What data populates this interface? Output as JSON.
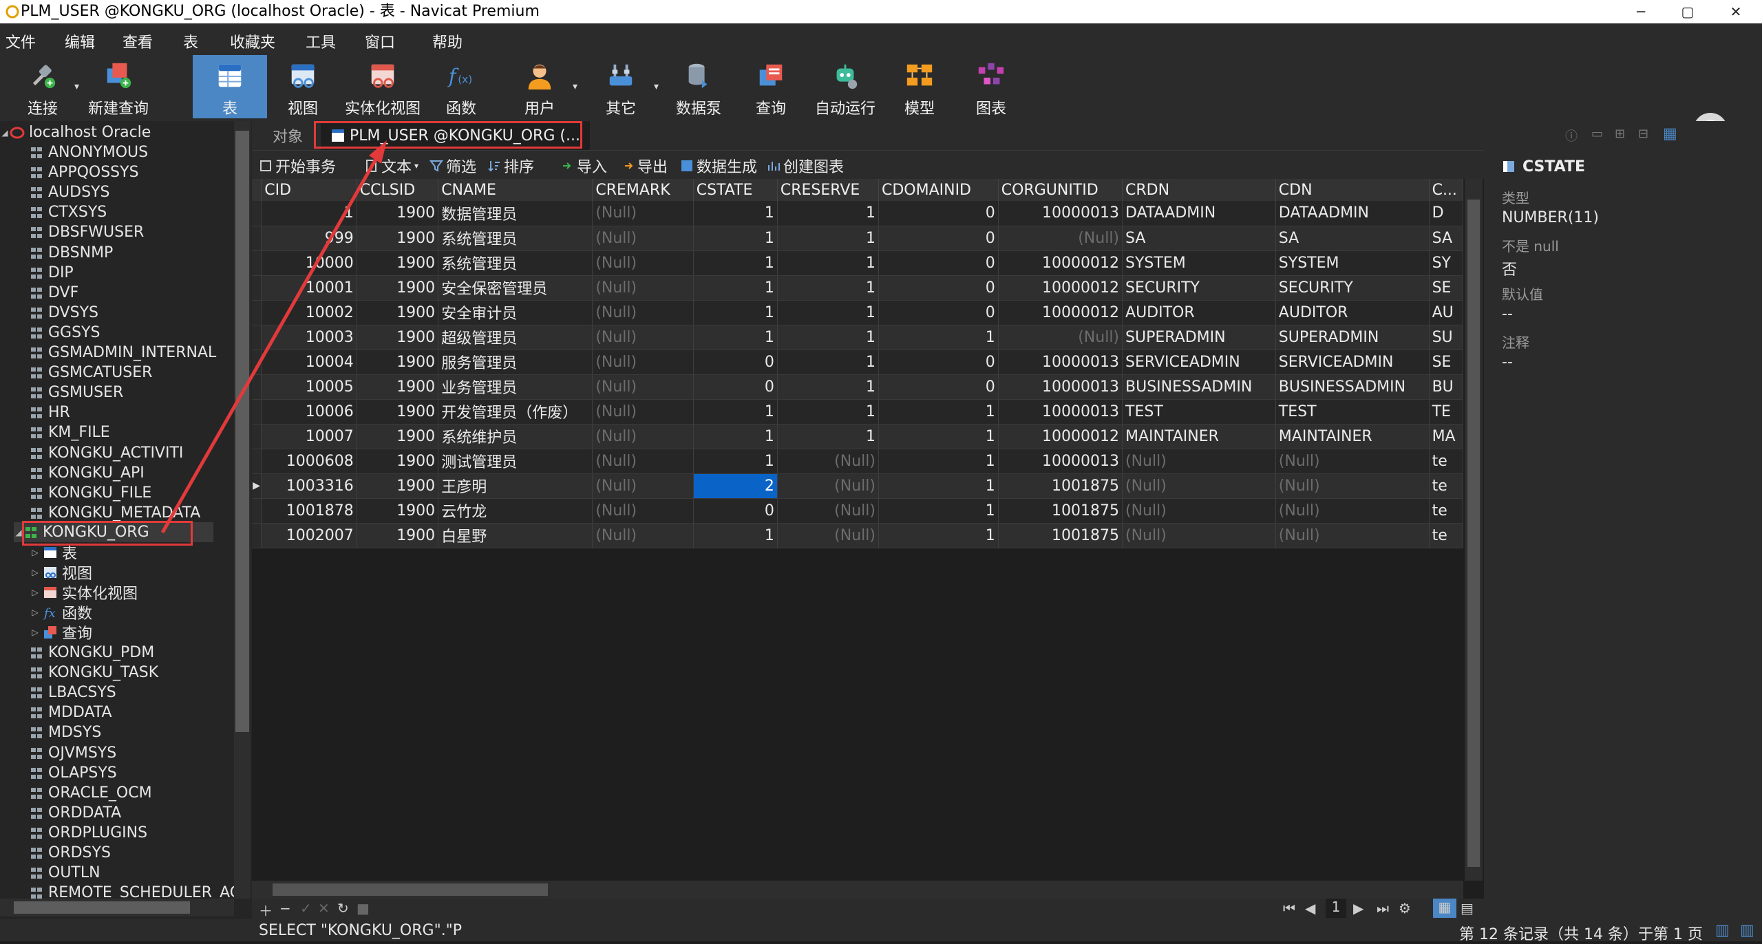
{
  "window": {
    "title": "PLM_USER @KONGKU_ORG (localhost Oracle) - 表 - Navicat Premium",
    "minimize": "─",
    "maximize": "▢",
    "close": "✕"
  },
  "menu": [
    "文件",
    "编辑",
    "查看",
    "表",
    "收藏夹",
    "工具",
    "窗口",
    "帮助"
  ],
  "toolbar": [
    {
      "label": "连接",
      "icon": "connect-icon"
    },
    {
      "label": "新建查询",
      "icon": "new-query-icon"
    },
    {
      "label": "表",
      "icon": "table-icon",
      "active": true
    },
    {
      "label": "视图",
      "icon": "view-icon"
    },
    {
      "label": "实体化视图",
      "icon": "materialized-view-icon"
    },
    {
      "label": "函数",
      "icon": "function-icon"
    },
    {
      "label": "用户",
      "icon": "user-icon"
    },
    {
      "label": "其它",
      "icon": "other-icon"
    },
    {
      "label": "数据泵",
      "icon": "data-pump-icon"
    },
    {
      "label": "查询",
      "icon": "query-icon"
    },
    {
      "label": "自动运行",
      "icon": "automation-icon"
    },
    {
      "label": "模型",
      "icon": "model-icon"
    },
    {
      "label": "图表",
      "icon": "chart-icon"
    }
  ],
  "sidebar": {
    "root": "localhost Oracle",
    "schemas_before": [
      "ANONYMOUS",
      "APPQOSSYS",
      "AUDSYS",
      "CTXSYS",
      "DBSFWUSER",
      "DBSNMP",
      "DIP",
      "DVF",
      "DVSYS",
      "GGSYS",
      "GSMADMIN_INTERNAL",
      "GSMCATUSER",
      "GSMUSER",
      "HR",
      "KM_FILE",
      "KONGKU_ACTIVITI",
      "KONGKU_API",
      "KONGKU_FILE",
      "KONGKU_METADATA"
    ],
    "selected_schema": "KONGKU_ORG",
    "children": [
      {
        "label": "表",
        "icon": "table-icon"
      },
      {
        "label": "视图",
        "icon": "view-icon"
      },
      {
        "label": "实体化视图",
        "icon": "materialized-view-icon"
      },
      {
        "label": "函数",
        "icon": "function-icon"
      },
      {
        "label": "查询",
        "icon": "query-icon"
      }
    ],
    "schemas_after": [
      "KONGKU_PDM",
      "KONGKU_TASK",
      "LBACSYS",
      "MDDATA",
      "MDSYS",
      "OJVMSYS",
      "OLAPSYS",
      "ORACLE_OCM",
      "ORDDATA",
      "ORDPLUGINS",
      "ORDSYS",
      "OUTLN",
      "REMOTE_SCHEDULER_AG"
    ]
  },
  "tabs": {
    "objects": "对象",
    "active": "PLM_USER @KONGKU_ORG (..."
  },
  "subtoolbar": [
    "开始事务",
    "文本",
    "筛选",
    "排序",
    "导入",
    "导出",
    "数据生成",
    "创建图表"
  ],
  "grid": {
    "columns": [
      "CID",
      "CCLSID",
      "CNAME",
      "CREMARK",
      "CSTATE",
      "CRESERVE",
      "CDOMAINID",
      "CORGUNITID",
      "CRDN",
      "CDN",
      "C..."
    ],
    "rows": [
      [
        "1",
        "1900",
        "数据管理员",
        "(Null)",
        "1",
        "1",
        "0",
        "10000013",
        "DATAADMIN",
        "DATAADMIN",
        "D"
      ],
      [
        "999",
        "1900",
        "系统管理员",
        "(Null)",
        "1",
        "1",
        "0",
        "(Null)",
        "SA",
        "SA",
        "SA"
      ],
      [
        "10000",
        "1900",
        "系统管理员",
        "(Null)",
        "1",
        "1",
        "0",
        "10000012",
        "SYSTEM",
        "SYSTEM",
        "SY"
      ],
      [
        "10001",
        "1900",
        "安全保密管理员",
        "(Null)",
        "1",
        "1",
        "0",
        "10000012",
        "SECURITY",
        "SECURITY",
        "SE"
      ],
      [
        "10002",
        "1900",
        "安全审计员",
        "(Null)",
        "1",
        "1",
        "0",
        "10000012",
        "AUDITOR",
        "AUDITOR",
        "AU"
      ],
      [
        "10003",
        "1900",
        "超级管理员",
        "(Null)",
        "1",
        "1",
        "1",
        "(Null)",
        "SUPERADMIN",
        "SUPERADMIN",
        "SU"
      ],
      [
        "10004",
        "1900",
        "服务管理员",
        "(Null)",
        "0",
        "1",
        "0",
        "10000013",
        "SERVICEADMIN",
        "SERVICEADMIN",
        "SE"
      ],
      [
        "10005",
        "1900",
        "业务管理员",
        "(Null)",
        "0",
        "1",
        "0",
        "10000013",
        "BUSINESSADMIN",
        "BUSINESSADMIN",
        "BU"
      ],
      [
        "10006",
        "1900",
        "开发管理员（作废）",
        "(Null)",
        "1",
        "1",
        "1",
        "10000013",
        "TEST",
        "TEST",
        "TE"
      ],
      [
        "10007",
        "1900",
        "系统维护员",
        "(Null)",
        "1",
        "1",
        "1",
        "10000012",
        "MAINTAINER",
        "MAINTAINER",
        "MA"
      ],
      [
        "1000608",
        "1900",
        "测试管理员",
        "(Null)",
        "1",
        "(Null)",
        "1",
        "10000013",
        "(Null)",
        "(Null)",
        "te"
      ],
      [
        "1003316",
        "1900",
        "王彦明",
        "(Null)",
        "2",
        "(Null)",
        "1",
        "1001875",
        "(Null)",
        "(Null)",
        "te"
      ],
      [
        "1001878",
        "1900",
        "云竹龙",
        "(Null)",
        "0",
        "(Null)",
        "1",
        "1001875",
        "(Null)",
        "(Null)",
        "te"
      ],
      [
        "1002007",
        "1900",
        "白星野",
        "(Null)",
        "1",
        "(Null)",
        "1",
        "1001875",
        "(Null)",
        "(Null)",
        "te"
      ]
    ],
    "selected_row": 11,
    "selected_col": 4,
    "footer_page": "1"
  },
  "rightpanel": {
    "field": "CSTATE",
    "type_label": "类型",
    "type_value": "NUMBER(11)",
    "notnull_label": "不是 null",
    "notnull_value": "否",
    "default_label": "默认值",
    "default_value": "--",
    "comment_label": "注释",
    "comment_value": "--"
  },
  "status": {
    "sql": "SELECT \"KONGKU_ORG\".\"P",
    "record": "第 12 条记录（共 14 条）于第 1 页"
  },
  "colors": {
    "accent": "#4b87c4",
    "selection": "#0a64c8",
    "annotation": "#e23a3a"
  }
}
